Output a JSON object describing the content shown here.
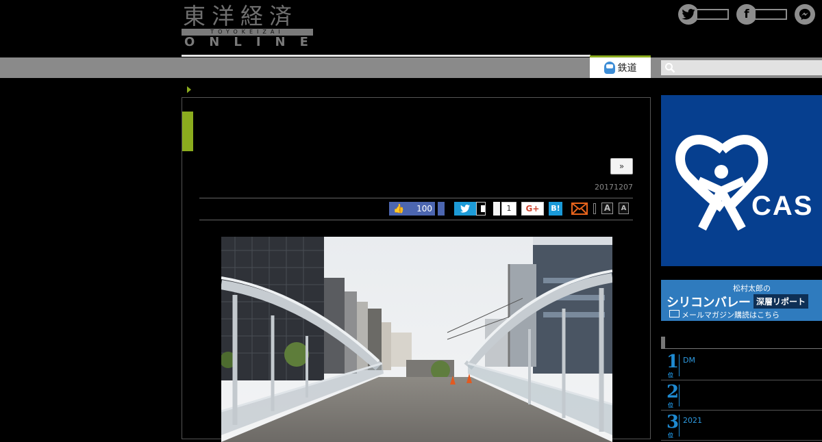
{
  "header": {
    "logo_kanji": "東洋経済",
    "logo_band": "TOYOKEIZAI",
    "logo_online": "ONLINE",
    "social": [
      {
        "name": "twitter",
        "glyph": ""
      },
      {
        "name": "facebook",
        "glyph": "f"
      },
      {
        "name": "messenger",
        "glyph": ""
      }
    ]
  },
  "nav": {
    "active_tab": "鉄道",
    "search_placeholder": ""
  },
  "article": {
    "more_button": "»",
    "date": "20171207",
    "share": {
      "facebook_count": "100",
      "pocket_count": "1",
      "gplus_label": "G+",
      "hatena_label": "B!",
      "font_large": "A",
      "font_small": "A"
    }
  },
  "ads": {
    "casa_text": "CAS",
    "silicon_line1": "松村太郎の",
    "silicon_line2": "シリコンバレー",
    "silicon_tag": "深層リポート",
    "silicon_line3": "メールマガジン購読はこちら"
  },
  "ranking": [
    {
      "rank": "1",
      "text": "DM"
    },
    {
      "rank": "2",
      "text": ""
    },
    {
      "rank": "3",
      "text": "2021"
    }
  ],
  "colors": {
    "accent_green": "#8bac1e",
    "ranking_blue": "#1f8ad1",
    "facebook": "#4c66b0",
    "twitter": "#1d9bd7",
    "casa_bg": "#063f8f"
  }
}
